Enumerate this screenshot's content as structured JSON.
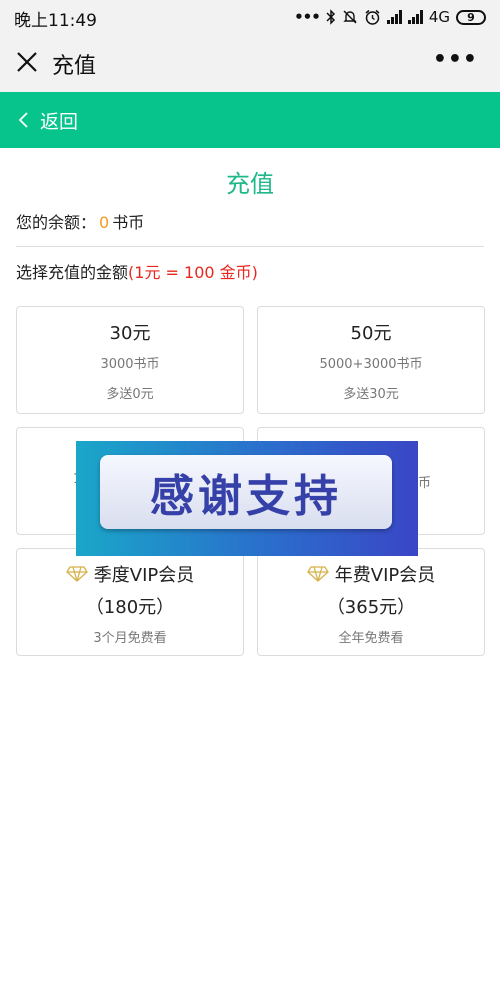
{
  "status_bar": {
    "time": "晚上11:49",
    "network": "4G",
    "battery_level": "9"
  },
  "title_bar": {
    "title": "充值"
  },
  "nav": {
    "back_label": "返回"
  },
  "page": {
    "heading": "充值",
    "balance_prefix": "您的余额：",
    "balance_value": "0",
    "balance_unit": "书币",
    "select_label": "选择充值的金额",
    "rate_note": "(1元 = 100 金币)"
  },
  "options": [
    {
      "amount": "30元",
      "coins": "3000书币",
      "bonus": "多送0元"
    },
    {
      "amount": "50元",
      "coins": "5000+3000书币",
      "bonus": "多送30元"
    }
  ],
  "partially_hidden": {
    "left_fragment": "1",
    "right_fragment": "币"
  },
  "vip": [
    {
      "title": "季度VIP会员",
      "price": "（180元）",
      "note": "3个月免费看"
    },
    {
      "title": "年费VIP会员",
      "price": "（365元）",
      "note": "全年免费看"
    }
  ],
  "overlay": {
    "text": "感谢支持"
  },
  "colors": {
    "accent_green": "#06c48c",
    "heading_green": "#1fb88a",
    "balance_orange": "#f29c1f",
    "rate_red": "#e8281e"
  }
}
